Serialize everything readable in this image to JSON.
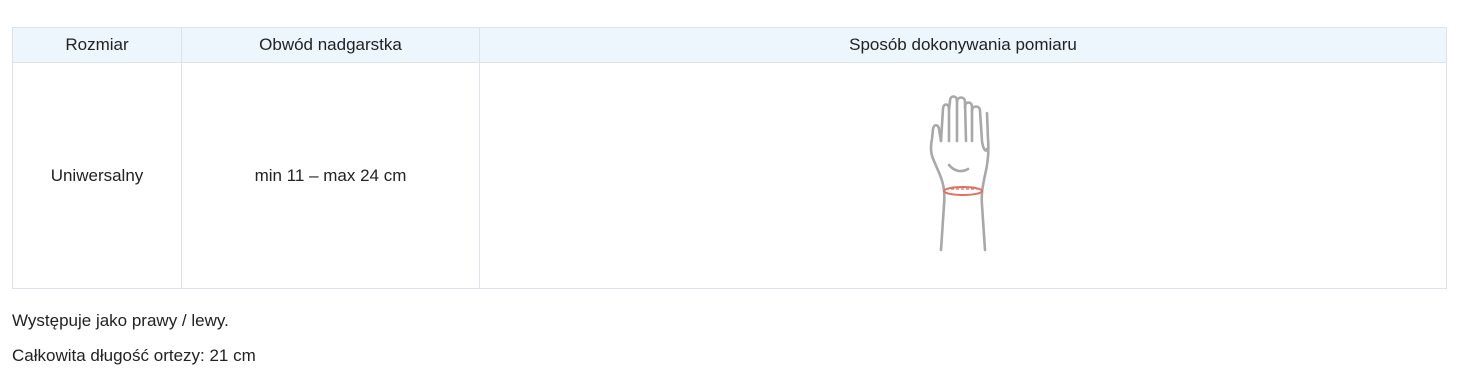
{
  "table": {
    "headers": {
      "size": "Rozmiar",
      "wrist": "Obwód nadgarstka",
      "method": "Sposób dokonywania pomiaru"
    },
    "rows": [
      {
        "size": "Uniwersalny",
        "wrist": "min 11 – max 24 cm",
        "method_illustration": "hand-wrist-measure-icon"
      }
    ]
  },
  "notes": {
    "sides": "Występuje jako prawy / lewy.",
    "length": "Całkowita długość ortezy: 21 cm"
  },
  "colors": {
    "header_bg": "#eef6fd",
    "border": "#dde3e8",
    "hand_stroke": "#a8a8a8",
    "measure_line": "#e0705f"
  }
}
